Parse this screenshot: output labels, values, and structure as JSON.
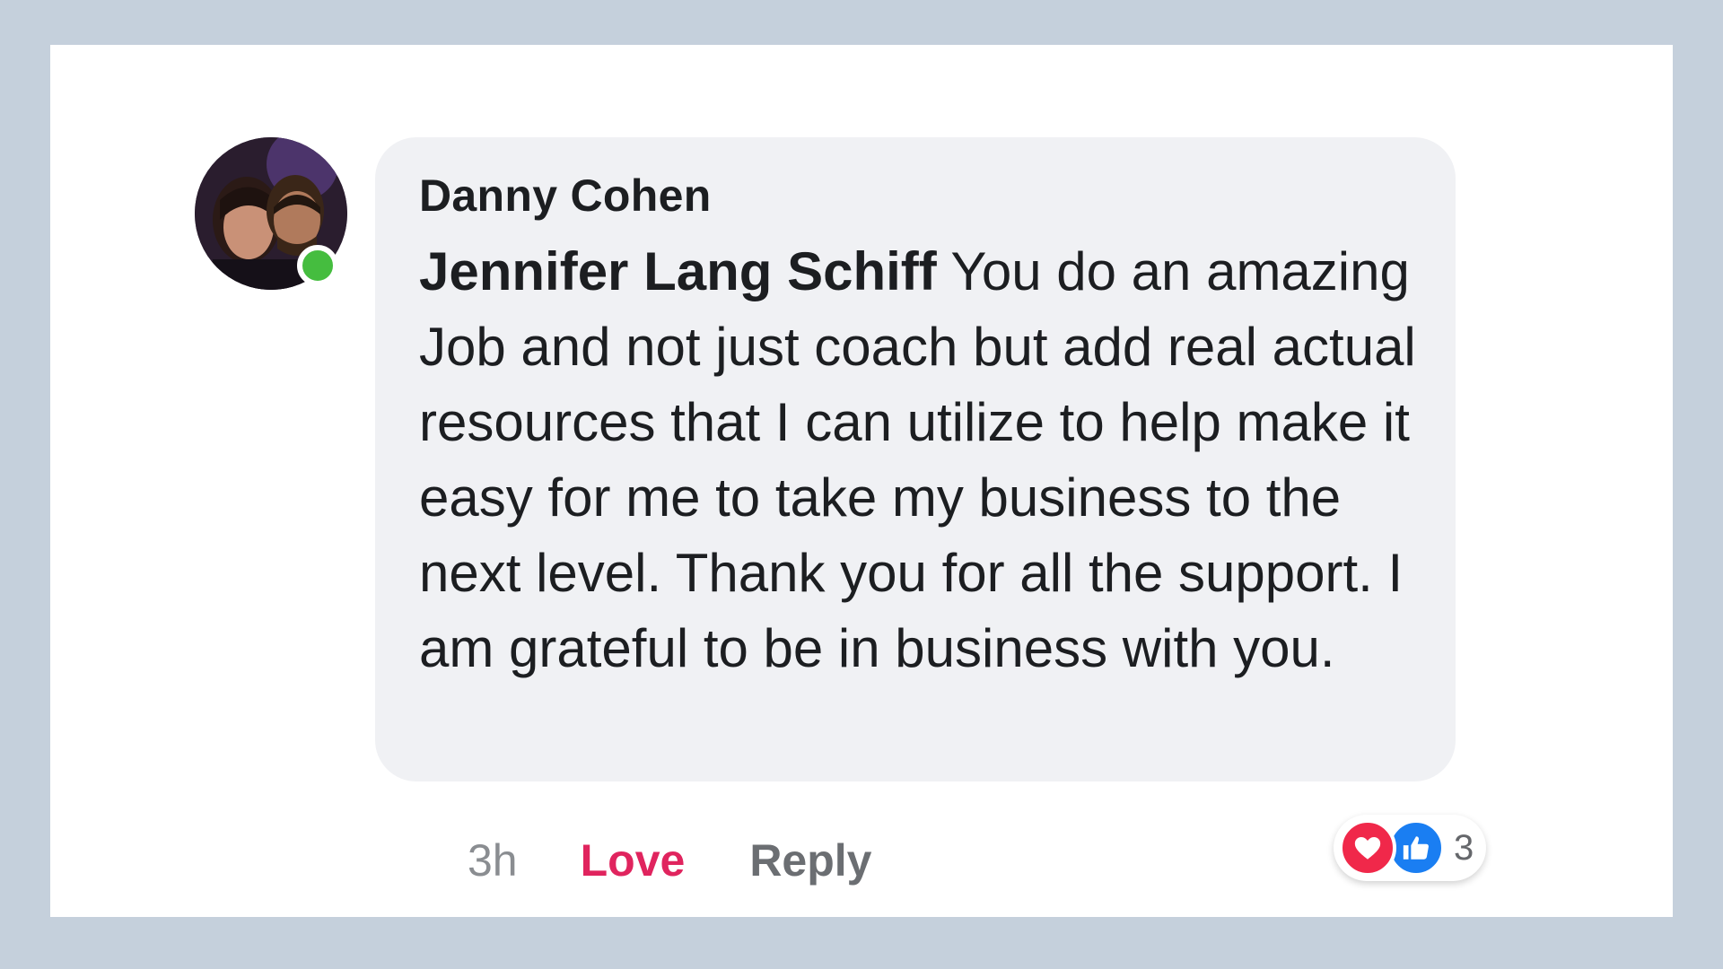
{
  "comment": {
    "author": "Danny Cohen",
    "mention": "Jennifer Lang Schiff",
    "text": " You do an amazing Job and not just coach but add real actual resources that I can utilize to help make it easy for me to take my business to the next level. Thank you for all the support. I am grateful to be in business with you.",
    "time": "3h",
    "love_label": "Love",
    "reply_label": "Reply",
    "reaction_count": "3",
    "reactions": [
      "heart-icon",
      "thumbs-up-icon"
    ]
  },
  "colors": {
    "background": "#c5d0dc",
    "bubble": "#f0f1f4",
    "love": "#e0245e",
    "online": "#45bd3f",
    "like": "#1a7ef2"
  }
}
